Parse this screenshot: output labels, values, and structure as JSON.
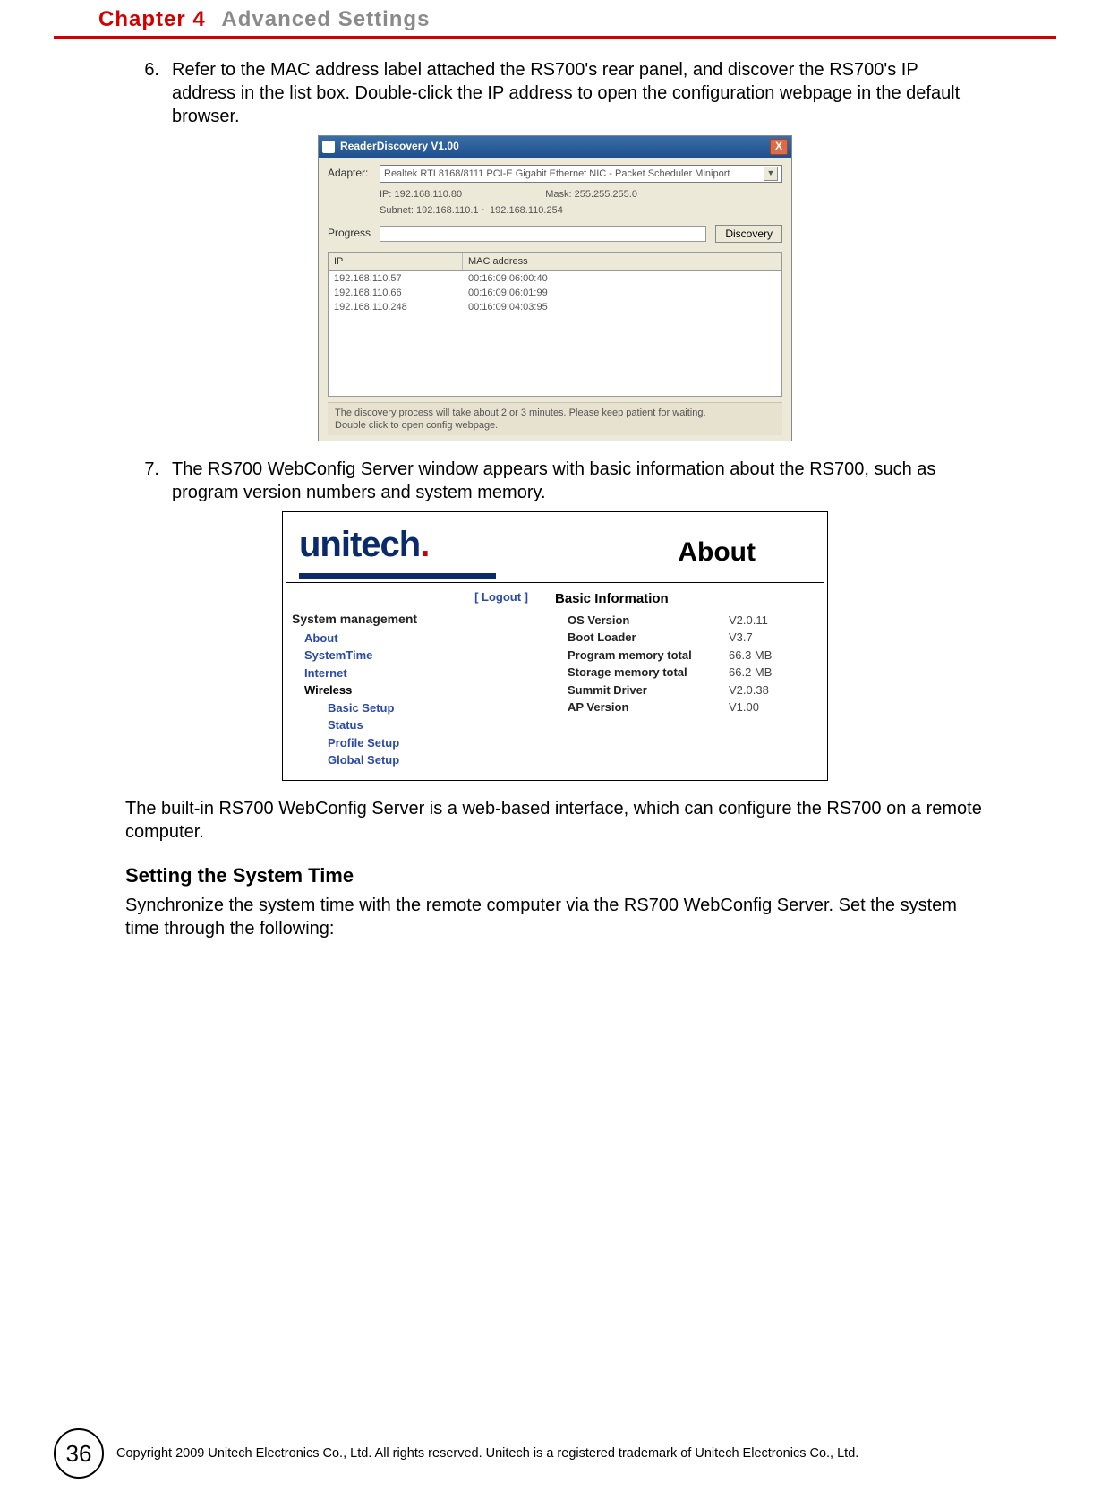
{
  "header": {
    "chapter": "Chapter 4",
    "title": "Advanced Settings"
  },
  "item6": {
    "num": "6.",
    "text": "Refer to the MAC address label attached the RS700's rear panel, and discover the RS700's IP address in the list box. Double-click the IP address to open the configuration webpage in the default browser."
  },
  "rd": {
    "title": "ReaderDiscovery V1.00",
    "adapter_label": "Adapter:",
    "adapter_value": "Realtek RTL8168/8111 PCI-E Gigabit Ethernet NIC - Packet Scheduler Miniport",
    "ip_label": "IP: 192.168.110.80",
    "mask_label": "Mask: 255.255.255.0",
    "subnet_label": "Subnet: 192.168.110.1 ~ 192.168.110.254",
    "progress_label": "Progress",
    "discovery_btn": "Discovery",
    "col_ip": "IP",
    "col_mac": "MAC address",
    "rows": [
      {
        "ip": "192.168.110.57",
        "mac": "00:16:09:06:00:40"
      },
      {
        "ip": "192.168.110.66",
        "mac": "00:16:09:06:01:99"
      },
      {
        "ip": "192.168.110.248",
        "mac": "00:16:09:04:03:95"
      }
    ],
    "hint1": "The discovery process will take about 2 or 3 minutes. Please keep patient for waiting.",
    "hint2": "Double click to open config webpage."
  },
  "item7": {
    "num": "7.",
    "text": "The RS700 WebConfig Server window appears with basic information about the RS700, such as program version numbers and system memory."
  },
  "wc": {
    "logo_main": "unitech",
    "about": "About",
    "logout": "[ Logout ]",
    "sys_head": "System management",
    "nav": {
      "about": "About",
      "systime": "SystemTime",
      "internet": "Internet",
      "wireless": "Wireless",
      "basic": "Basic Setup",
      "status": "Status",
      "profile": "Profile Setup",
      "global": "Global Setup"
    },
    "bi_head": "Basic Information",
    "bi": [
      {
        "k": "OS Version",
        "v": "V2.0.11"
      },
      {
        "k": "Boot Loader",
        "v": "V3.7"
      },
      {
        "k": "Program memory total",
        "v": "66.3 MB"
      },
      {
        "k": "Storage memory total",
        "v": "66.2 MB"
      },
      {
        "k": "Summit Driver",
        "v": "V2.0.38"
      },
      {
        "k": "AP Version",
        "v": "V1.00"
      }
    ]
  },
  "para1": "The built-in RS700 WebConfig Server is a web-based interface, which can configure the RS700 on a remote computer.",
  "h3": "Setting the System Time",
  "para2": "Synchronize the system time with the remote computer via the RS700 WebConfig Server. Set the system time through the following:",
  "page_num": "36",
  "copyright": "Copyright 2009 Unitech Electronics Co., Ltd. All rights reserved. Unitech is a registered trademark of Unitech Electronics Co., Ltd."
}
